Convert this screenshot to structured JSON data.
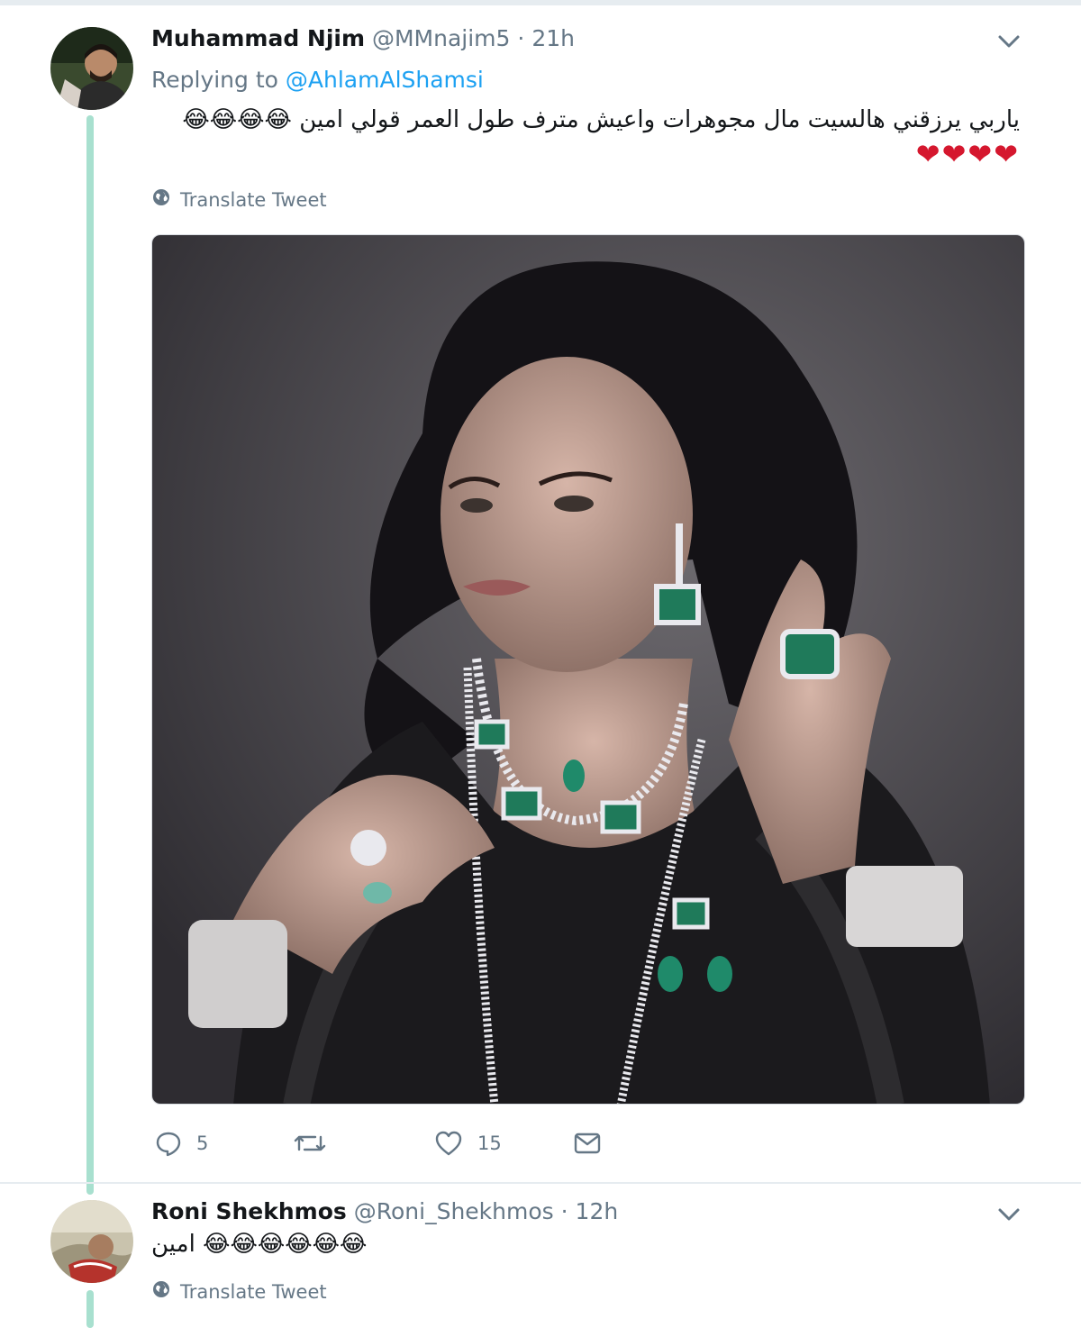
{
  "tweets": [
    {
      "name": "Muhammad Njim",
      "handle": "@MMnajim5",
      "separator": "·",
      "time": "21h",
      "replying_label": "Replying to",
      "replying_to": "@AhlamAlShamsi",
      "text": "ياربي يرزقني هالسيت مال مجوهرات واعيش مترف طول العمر قولي امين",
      "emoji": "😂😂😂😂",
      "hearts": "❤❤❤❤",
      "translate_label": "Translate Tweet",
      "replies": "5",
      "likes": "15"
    },
    {
      "name": "Roni Shekhmos",
      "handle": "@Roni_Shekhmos",
      "separator": "·",
      "time": "12h",
      "text": "امين",
      "emoji": "😂😂😂😂😂😂",
      "translate_label": "Translate Tweet"
    }
  ],
  "colors": {
    "accent": "#1da1f2",
    "thread_line": "#a8e0cf",
    "secondary_text": "#657786",
    "heart": "#d5172e"
  },
  "icons": [
    "chevron-down-icon",
    "globe-icon",
    "reply-icon",
    "retweet-icon",
    "like-icon",
    "message-icon"
  ]
}
